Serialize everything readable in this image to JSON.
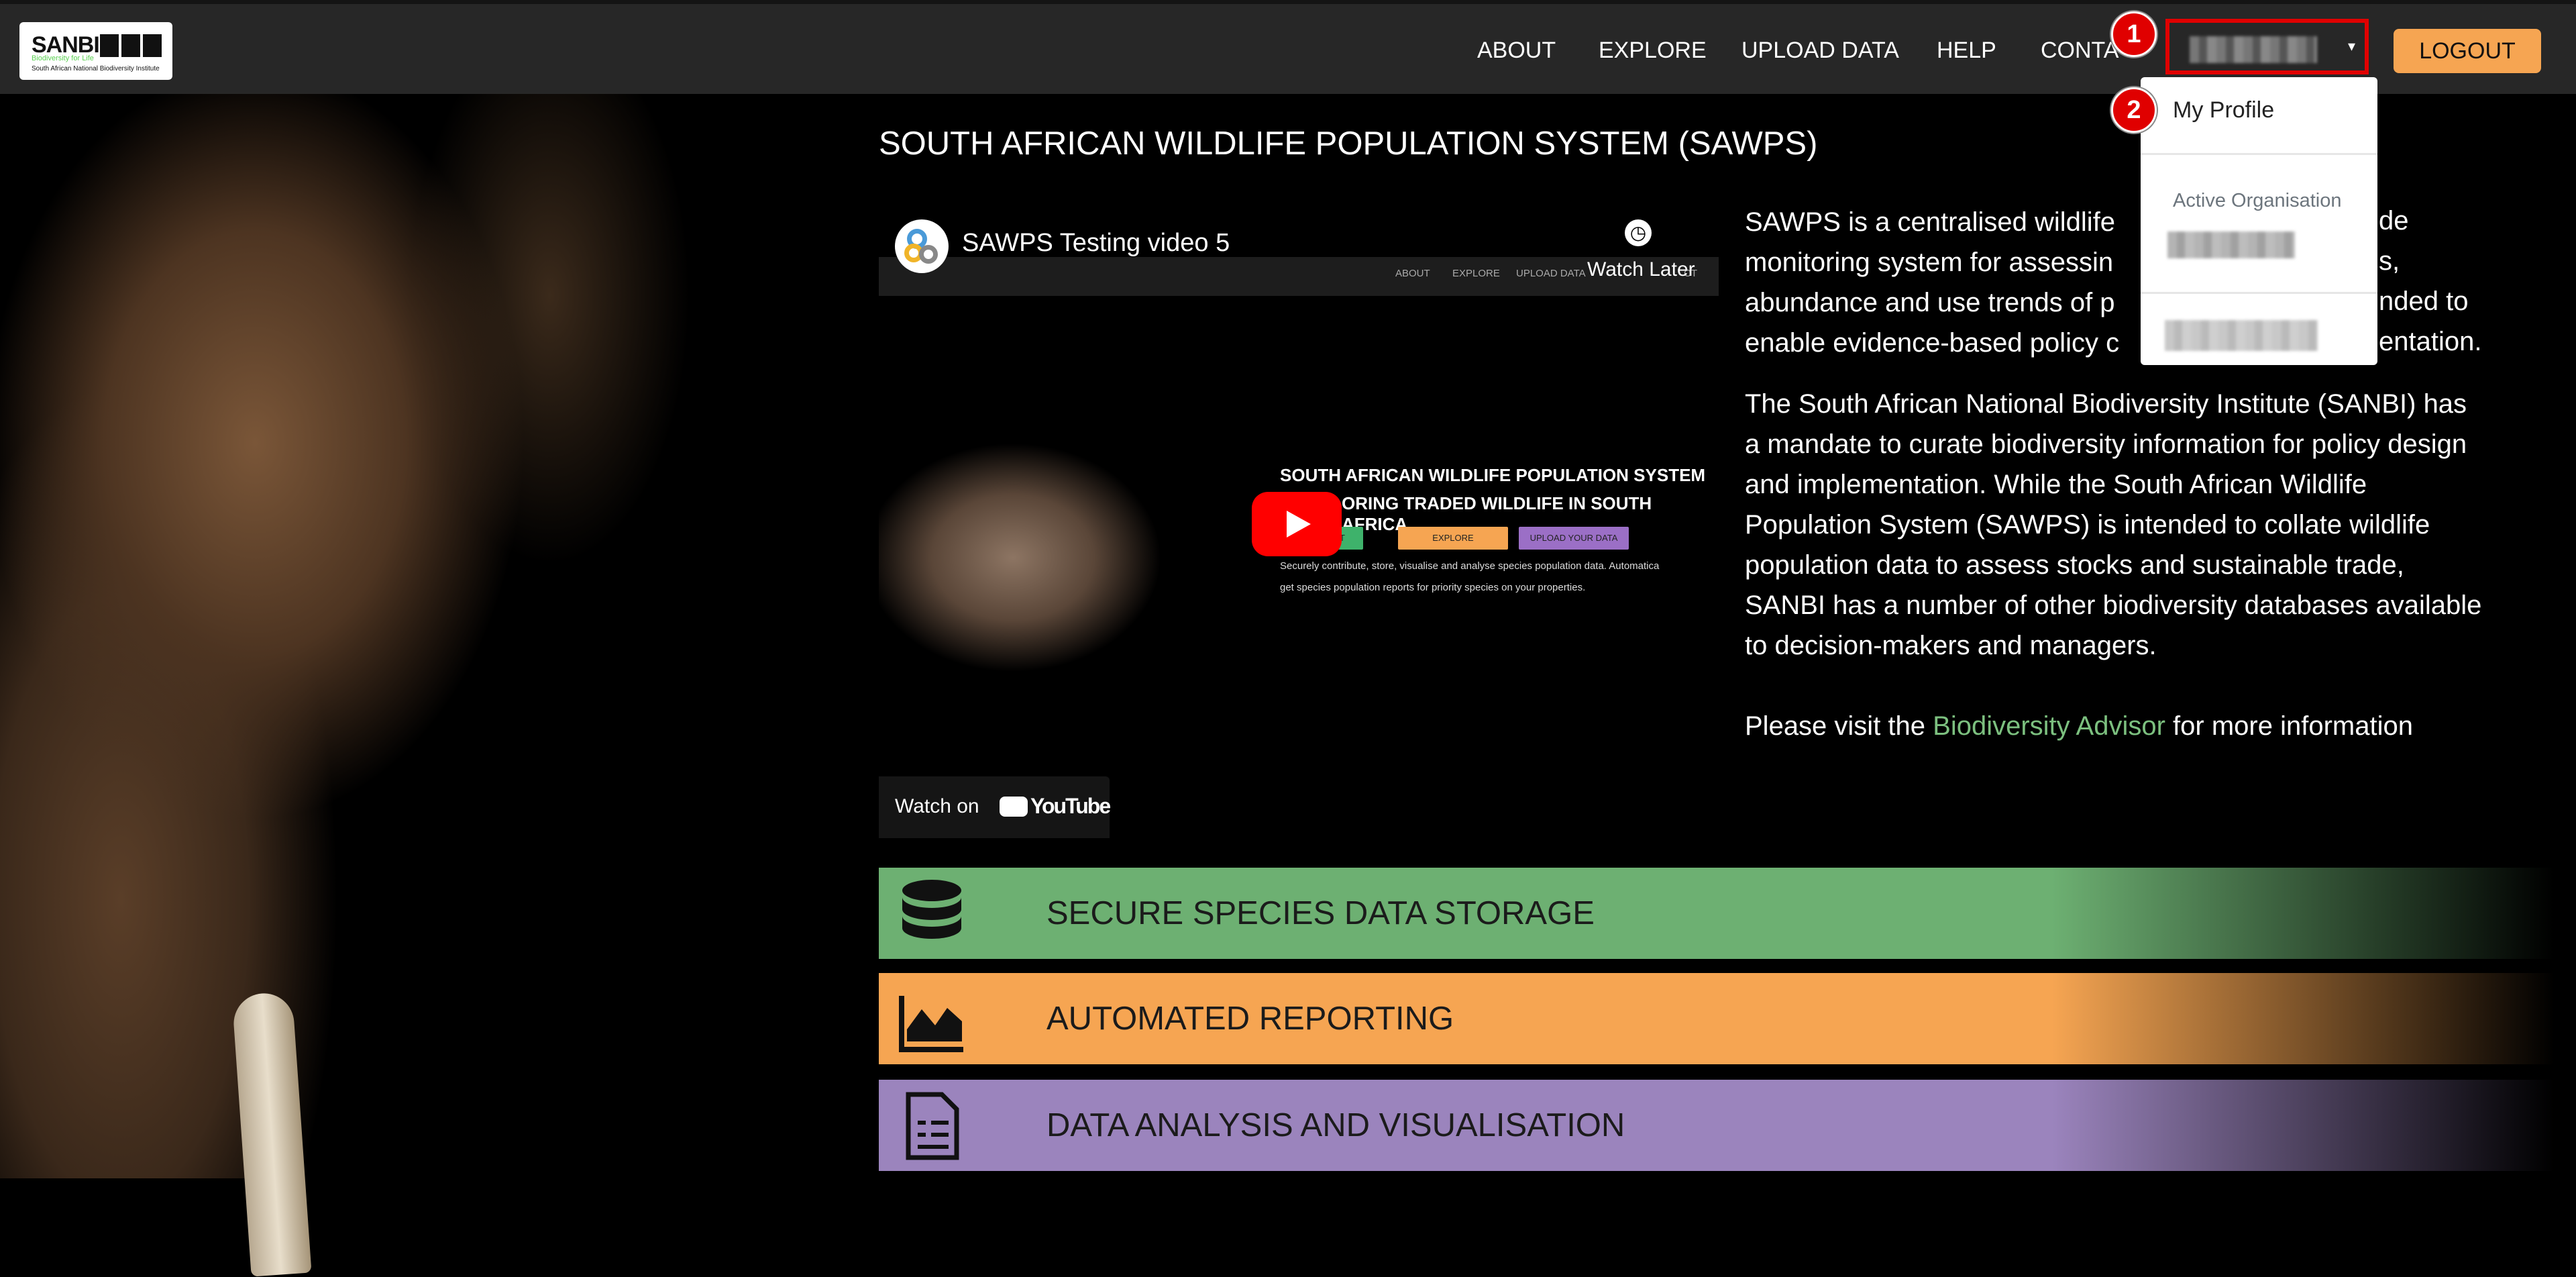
{
  "header": {
    "logo": {
      "name": "SANBI",
      "tagline": "Biodiversity for Life",
      "full_name": "South African National Biodiversity Institute"
    },
    "nav": [
      "ABOUT",
      "EXPLORE",
      "UPLOAD DATA",
      "HELP",
      "CONTA"
    ],
    "logout": "LOGOUT"
  },
  "annotations": [
    "1",
    "2"
  ],
  "dropdown": {
    "my_profile": "My Profile",
    "active_org_label": "Active Organisation"
  },
  "page_title": "SOUTH AFRICAN WILDLIFE POPULATION SYSTEM (SAWPS)",
  "video": {
    "title": "SAWPS Testing video 5",
    "watch_later": "Watch Later",
    "inner_nav": [
      "ABOUT",
      "EXPLORE",
      "UPLOAD DATA",
      "CT"
    ],
    "headline1": "SOUTH AFRICAN WILDLIFE POPULATION SYSTEM",
    "headline2": "ORING TRADED WILDLIFE IN SOUTH AFRICA",
    "buttons": [
      "T",
      "EXPLORE",
      "UPLOAD YOUR DATA"
    ],
    "desc1": "Securely contribute, store, visualise and analyse species population data. Automatica",
    "desc2": "get species population reports for priority species on your properties.",
    "watch_on": "Watch on",
    "youtube": "YouTube"
  },
  "intro": {
    "lines_left": [
      "SAWPS is a centralised wildlife",
      "monitoring system for assessin",
      "abundance and use trends of p",
      "enable evidence-based policy c"
    ],
    "lines_right": [
      "de",
      "s,",
      "nded to",
      "entation."
    ]
  },
  "para2": [
    "The South African National Biodiversity Institute (SANBI) has",
    "a mandate to curate biodiversity information for policy design",
    "and implementation. While the South African Wildlife",
    "Population System (SAWPS) is intended to collate wildlife",
    "population data to assess stocks and sustainable trade,",
    "SANBI has a number of other biodiversity databases available",
    "to decision-makers and managers."
  ],
  "visit": {
    "before": "Please visit the ",
    "link": "Biodiversity Advisor",
    "after": " for more information"
  },
  "features": [
    {
      "label": "SECURE SPECIES DATA STORAGE",
      "icon": "database-icon",
      "color": "#6db072"
    },
    {
      "label": "AUTOMATED REPORTING",
      "icon": "chart-area-icon",
      "color": "#f6a552"
    },
    {
      "label": "DATA ANALYSIS AND VISUALISATION",
      "icon": "document-icon",
      "color": "#9b84bd"
    }
  ]
}
